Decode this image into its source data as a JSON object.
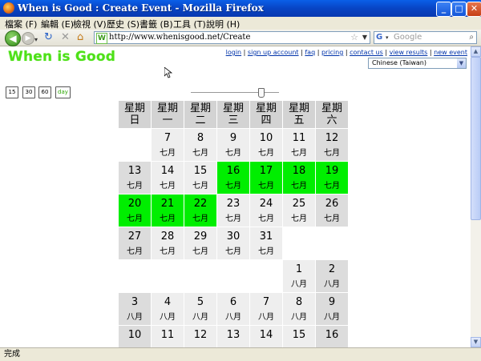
{
  "window": {
    "title": "When is Good : Create Event - Mozilla Firefox"
  },
  "menu": [
    "檔案 (F)",
    "編輯 (E)",
    "檢視 (V)",
    "歷史 (S)",
    "書籤 (B)",
    "工具 (T)",
    "說明 (H)"
  ],
  "navbar": {
    "url": "http://www.whenisgood.net/Create",
    "search_placeholder": "Google"
  },
  "page": {
    "logo": "When is Good",
    "links": [
      "login",
      "sign up account",
      "faq",
      "pricing",
      "contact us",
      "view results",
      "new event"
    ],
    "language": "Chinese (Taiwan)",
    "zoom_buttons": [
      "15",
      "30",
      "60",
      "day"
    ],
    "slider_level": 0.8
  },
  "calendar": {
    "headers": [
      [
        "星期",
        "日"
      ],
      [
        "星期",
        "一"
      ],
      [
        "星期",
        "二"
      ],
      [
        "星期",
        "三"
      ],
      [
        "星期",
        "四"
      ],
      [
        "星期",
        "五"
      ],
      [
        "星期",
        "六"
      ]
    ],
    "weeks": [
      [
        null,
        [
          "7",
          "七月"
        ],
        [
          "8",
          "七月"
        ],
        [
          "9",
          "七月"
        ],
        [
          "10",
          "七月"
        ],
        [
          "11",
          "七月"
        ],
        [
          "12",
          "七月"
        ]
      ],
      [
        [
          "13",
          "七月"
        ],
        [
          "14",
          "七月"
        ],
        [
          "15",
          "七月"
        ],
        [
          "16",
          "七月",
          "sel"
        ],
        [
          "17",
          "七月",
          "sel"
        ],
        [
          "18",
          "七月",
          "sel"
        ],
        [
          "19",
          "七月",
          "sel"
        ]
      ],
      [
        [
          "20",
          "七月",
          "sel"
        ],
        [
          "21",
          "七月",
          "sel"
        ],
        [
          "22",
          "七月",
          "sel"
        ],
        [
          "23",
          "七月"
        ],
        [
          "24",
          "七月"
        ],
        [
          "25",
          "七月"
        ],
        [
          "26",
          "七月"
        ]
      ],
      [
        [
          "27",
          "七月"
        ],
        [
          "28",
          "七月"
        ],
        [
          "29",
          "七月"
        ],
        [
          "30",
          "七月"
        ],
        [
          "31",
          "七月"
        ],
        null,
        null
      ],
      [
        null,
        null,
        null,
        null,
        null,
        [
          "1",
          "八月"
        ],
        [
          "2",
          "八月"
        ]
      ],
      [
        [
          "3",
          "八月"
        ],
        [
          "4",
          "八月"
        ],
        [
          "5",
          "八月"
        ],
        [
          "6",
          "八月"
        ],
        [
          "7",
          "八月"
        ],
        [
          "8",
          "八月"
        ],
        [
          "9",
          "八月"
        ]
      ],
      [
        [
          "10",
          ""
        ],
        [
          "11",
          ""
        ],
        [
          "12",
          ""
        ],
        [
          "13",
          ""
        ],
        [
          "14",
          ""
        ],
        [
          "15",
          ""
        ],
        [
          "16",
          ""
        ]
      ]
    ]
  },
  "status": {
    "text": "完成"
  }
}
